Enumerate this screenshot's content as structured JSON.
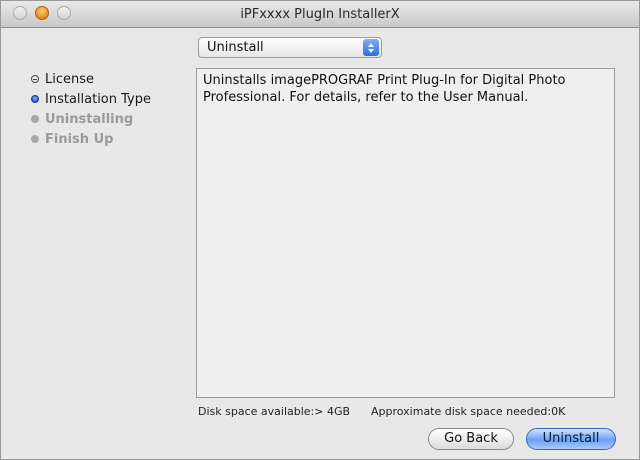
{
  "window": {
    "title": "iPFxxxx PlugIn InstallerX"
  },
  "steps": [
    {
      "label": "License",
      "state": "done"
    },
    {
      "label": "Installation Type",
      "state": "current"
    },
    {
      "label": "Uninstalling",
      "state": "pending"
    },
    {
      "label": "Finish Up",
      "state": "pending"
    }
  ],
  "mode_select": {
    "selected": "Uninstall"
  },
  "description": "Uninstalls imagePROGRAF Print Plug-In for Digital Photo Professional. For details, refer to the User Manual.",
  "disk": {
    "available": "Disk space available:> 4GB",
    "needed": "Approximate disk space needed:0K"
  },
  "buttons": {
    "back": "Go Back",
    "primary": "Uninstall"
  },
  "colors": {
    "accent": "#2a6de0",
    "window_bg": "#e8e8e8"
  }
}
